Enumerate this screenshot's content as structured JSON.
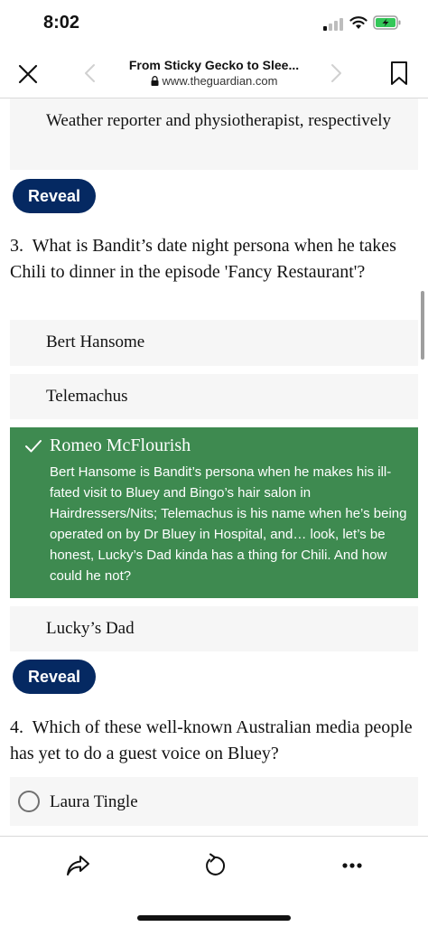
{
  "status_bar": {
    "time": "8:02"
  },
  "nav": {
    "title": "From Sticky Gecko to Slee...",
    "url": "www.theguardian.com"
  },
  "question2": {
    "answer_d": "Weather reporter and physiotherapist, respectively",
    "reveal_label": "Reveal"
  },
  "question3": {
    "number": "3.",
    "text": "What is Bandit’s date night persona when he takes Chili to dinner in the episode 'Fancy Restaurant'?",
    "answers": [
      "Bert Hansome",
      "Telemachus",
      "Romeo McFlourish",
      "Lucky’s Dad"
    ],
    "correct_label": "Romeo McFlourish",
    "correct_explanation": "Bert Hansome is Bandit’s persona when he makes his ill-fated visit to Bluey and Bingo’s hair salon in Hairdressers/Nits; Telemachus is his name when he’s being operated on by Dr Bluey in Hospital, and… look, let’s be honest, Lucky’s Dad kinda has a thing for Chili. And how could he not?",
    "reveal_label": "Reveal"
  },
  "question4": {
    "number": "4.",
    "text": "Which of these well-known Australian media people has yet to do a guest voice on Bluey?",
    "answers": [
      "Laura Tingle"
    ]
  },
  "colors": {
    "reveal_button": "#052962",
    "correct_answer": "#3e8a50",
    "answer_background": "#f6f6f6"
  },
  "icons": [
    "close-icon",
    "back-chevron-icon",
    "forward-chevron-icon",
    "bookmark-icon",
    "lock-icon",
    "share-icon",
    "reload-icon",
    "more-icon",
    "check-icon"
  ]
}
